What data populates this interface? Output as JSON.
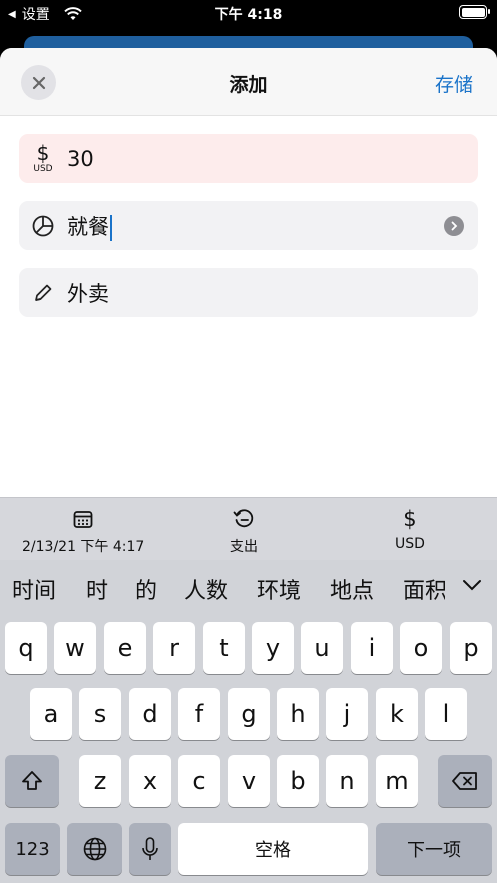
{
  "status_bar": {
    "back_label": "设置",
    "time": "下午 4:18"
  },
  "nav": {
    "title": "添加",
    "save": "存储"
  },
  "amount": {
    "currency_symbol": "$",
    "currency_code": "USD",
    "value": "30"
  },
  "category": {
    "value": "就餐"
  },
  "note": {
    "value": "外卖"
  },
  "toolbar": {
    "date": "2/13/21 下午 4:17",
    "type": "支出",
    "currency_symbol": "$",
    "currency": "USD"
  },
  "suggestions": [
    "时间",
    "时",
    "的",
    "人数",
    "环境",
    "地点",
    "面积"
  ],
  "keys": {
    "row1": [
      "q",
      "w",
      "e",
      "r",
      "t",
      "y",
      "u",
      "i",
      "o",
      "p"
    ],
    "row2": [
      "a",
      "s",
      "d",
      "f",
      "g",
      "h",
      "j",
      "k",
      "l"
    ],
    "row3": [
      "z",
      "x",
      "c",
      "v",
      "b",
      "n",
      "m"
    ],
    "numbers": "123",
    "space": "空格",
    "next": "下一项"
  }
}
